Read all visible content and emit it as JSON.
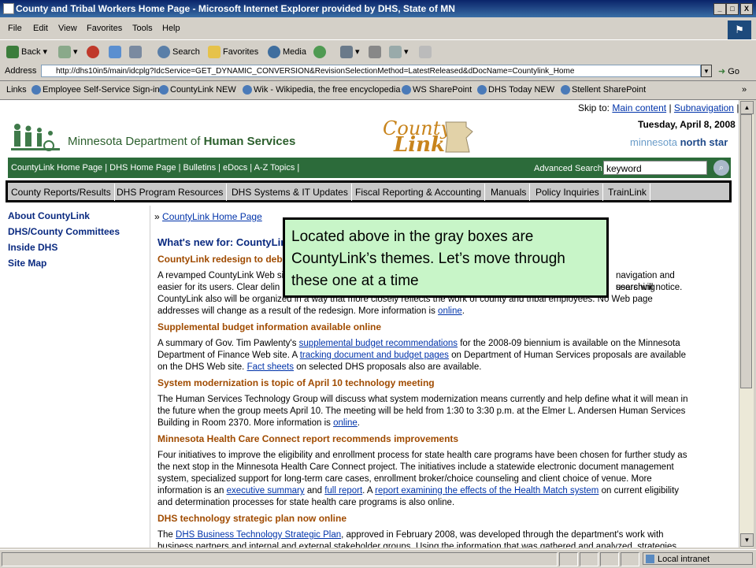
{
  "window": {
    "title": "County and Tribal Workers Home Page - Microsoft Internet Explorer provided by DHS, State of MN",
    "min": "_",
    "max": "□",
    "close": "X"
  },
  "menu": [
    "File",
    "Edit",
    "View",
    "Favorites",
    "Tools",
    "Help"
  ],
  "toolbar": {
    "back": "Back",
    "search": "Search",
    "favorites": "Favorites",
    "media": "Media"
  },
  "address": {
    "label": "Address",
    "url": "http://dhs10in5/main/idcplg?IdcService=GET_DYNAMIC_CONVERSION&RevisionSelectionMethod=LatestReleased&dDocName=Countylink_Home",
    "go": "Go"
  },
  "links": {
    "label": "Links",
    "items": [
      "Employee Self-Service Sign-in",
      "CountyLink NEW",
      "Wik - Wikipedia, the free encyclopedia",
      "WS SharePoint",
      "DHS Today NEW",
      "Stellent SharePoint"
    ],
    "more": "»"
  },
  "header": {
    "skip_prefix": "Skip to:",
    "skip_main": "Main content",
    "skip_sep": "|",
    "skip_sub": "Subnavigation",
    "skip_end": "|",
    "date": "Tuesday, April 8, 2008",
    "dept_prefix": "Minnesota Department of ",
    "dept_bold": "Human Services",
    "countylink_top": "County",
    "countylink_bottom": "Link",
    "mn_light": "minnesota ",
    "mn_bold": "north star"
  },
  "green_nav": {
    "items": "CountyLink Home Page | DHS Home Page | Bulletins | eDocs | A-Z Topics |",
    "advanced_search": "Advanced Search",
    "keyword": "keyword"
  },
  "themes": [
    "County Reports/Results",
    "DHS Program Resources",
    "DHS Systems & IT Updates",
    "Fiscal Reporting & Accounting",
    "Manuals",
    "Policy Inquiries",
    "TrainLink"
  ],
  "left_nav": [
    "About CountyLink",
    "DHS/County Committees",
    "Inside DHS",
    "Site Map"
  ],
  "breadcrumb": {
    "arrow": "»",
    "link": "CountyLink Home Page"
  },
  "whats_new": "What's new for: CountyLink",
  "articles": [
    {
      "heading": "CountyLink redesign to debut",
      "p1": "A revamped CountyLink Web site ",
      "p1b": "navigation and searching",
      "p2": "easier for its users. Clear delin",
      "p2b": "users will notice.",
      "p3": "CountyLink also will be organized in a way that more closely reflects the work of county and tribal employees. No Web page",
      "p4": "addresses will change as a result of the redesign. More information is ",
      "link": "online",
      "end": "."
    },
    {
      "heading": "Supplemental budget information available online",
      "t1": "A summary of Gov. Tim Pawlenty's ",
      "l1": "supplemental budget recommendations",
      "t2": " for the 2008-09 biennium is available on the Minnesota",
      "t3": "Department of Finance Web site. A ",
      "l2": "tracking document and budget pages",
      "t4": " on Department of Human Services proposals are available",
      "t5": "on the DHS Web site. ",
      "l3": "Fact sheets",
      "t6": " on selected DHS proposals also are available."
    },
    {
      "heading": "System modernization is topic of April 10 technology meeting",
      "t1": "The Human Services Technology Group will discuss what system modernization means currently and help define what it will mean in",
      "t2": "the future when the group meets April 10. The meeting will be held from 1:30 to 3:30 p.m. at the Elmer L. Andersen Human Services",
      "t3": "Building in Room 2370. More information is ",
      "link": "online",
      "end": "."
    },
    {
      "heading": "Minnesota Health Care Connect report recommends improvements",
      "t1": "Four initiatives to improve the eligibility and enrollment process for state health care programs have been chosen for further study as",
      "t2": "the next stop in the Minnesota Health Care Connect project. The initiatives include a statewide electronic document management",
      "t3": "system, specialized support for long-term care cases, enrollment broker/choice counseling and client choice of venue. More",
      "t4": "information is an ",
      "l1": "executive summary",
      "t5": " and ",
      "l2": "full report",
      "t6": ". A ",
      "l3": "report examining the effects of the Health Match system",
      "t7": " on current eligibility",
      "t8": "and determination processes for state health care programs is also online."
    },
    {
      "heading": "DHS technology strategic plan now online",
      "t1": "The ",
      "l1": "DHS Business Technology Strategic Plan",
      "t2": ", approved in February 2008, was developed through the department's work with",
      "t3": "business partners and internal and external stakeholder groups. Using the information that was gathered and analyzed, strategies"
    }
  ],
  "callout": "Located above in the gray boxes are CountyLink’s themes. Let’s move through these one at a time",
  "status": {
    "zone": "Local intranet"
  }
}
